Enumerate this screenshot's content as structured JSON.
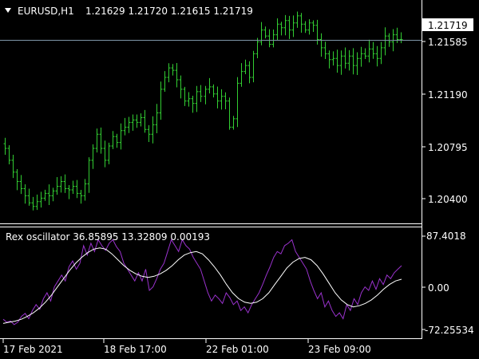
{
  "price_panel": {
    "symbol_label": "EURUSD,H1",
    "ohlc": "1.21629 1.21720 1.21615 1.21719",
    "current_price": "1.21719",
    "y_ticks": [
      "1.21585",
      "1.21190",
      "1.20795",
      "1.20400"
    ],
    "bar_color": "#32CD32",
    "current_line_color": "#7f96a8"
  },
  "oscillator_panel": {
    "title": "Rex oscillator 36.85895 13.32809 0.00193",
    "y_ticks": [
      "87.4018",
      "0.00",
      "-72.25534"
    ],
    "rex_color": "#9932CC",
    "signal_color": "#FFFFFF"
  },
  "time_axis": {
    "labels": [
      "17 Feb 2021",
      "18 Feb 17:00",
      "22 Feb 01:00",
      "23 Feb 09:00"
    ]
  },
  "chart_data": [
    {
      "type": "bar",
      "title": "EURUSD,H1",
      "ylim": [
        1.2018,
        1.22
      ],
      "y_ticks": [
        1.21585,
        1.2119,
        1.20795,
        1.204
      ],
      "closes": [
        1.208,
        1.207,
        1.206,
        1.2052,
        1.2046,
        1.204,
        1.2034,
        1.2031,
        1.2035,
        1.2038,
        1.2042,
        1.204,
        1.2044,
        1.2048,
        1.2052,
        1.2046,
        1.2045,
        1.2048,
        1.2042,
        1.204,
        1.205,
        1.207,
        1.208,
        1.2092,
        1.208,
        1.207,
        1.2082,
        1.209,
        1.2085,
        1.2095,
        1.2098,
        1.2102,
        1.2104,
        1.2102,
        1.2106,
        1.2096,
        1.2092,
        1.21,
        1.211,
        1.213,
        1.214,
        1.2148,
        1.2146,
        1.2138,
        1.213,
        1.212,
        1.2122,
        1.2118,
        1.2128,
        1.2124,
        1.213,
        1.2132,
        1.2126,
        1.212,
        1.2124,
        1.212,
        1.2098,
        1.2105,
        1.2135,
        1.2145,
        1.215,
        1.214,
        1.216,
        1.217,
        1.218,
        1.2175,
        1.2168,
        1.2176,
        1.2185,
        1.2182,
        1.2188,
        1.218,
        1.2186,
        1.2192,
        1.2185,
        1.218,
        1.2186,
        1.2184,
        1.2172,
        1.2165,
        1.216,
        1.2155,
        1.2156,
        1.215,
        1.2158,
        1.2152,
        1.2158,
        1.215,
        1.2156,
        1.216,
        1.2158,
        1.2164,
        1.216,
        1.2156,
        1.2165,
        1.2175,
        1.217,
        1.2176,
        1.2172,
        1.21719
      ]
    },
    {
      "type": "line",
      "title": "Rex oscillator 36.85895 13.32809 0.00193",
      "ylim": [
        -72.25534,
        87.4018
      ],
      "series": [
        {
          "values": [
            -55,
            -60,
            -58,
            -64,
            -60,
            -50,
            -45,
            -54,
            -40,
            -30,
            -38,
            -20,
            -10,
            -24,
            0,
            10,
            20,
            10,
            34,
            44,
            30,
            40,
            70,
            54,
            74,
            60,
            80,
            70,
            62,
            74,
            80,
            68,
            60,
            40,
            30,
            20,
            10,
            24,
            10,
            30,
            -6,
            0,
            14,
            30,
            40,
            60,
            80,
            70,
            60,
            80,
            70,
            64,
            50,
            40,
            30,
            10,
            -10,
            -24,
            -14,
            -20,
            -28,
            -10,
            -18,
            -30,
            -24,
            -40,
            -34,
            -44,
            -30,
            -20,
            -10,
            4,
            20,
            34,
            50,
            60,
            56,
            70,
            74,
            80,
            60,
            50,
            40,
            30,
            10,
            -6,
            -20,
            -10,
            -34,
            -24,
            -40,
            -50,
            -44,
            -54,
            -30,
            -40,
            -20,
            -30,
            -10,
            0,
            -6,
            10,
            -4,
            14,
            4,
            20,
            14,
            24,
            30,
            36
          ]
        },
        {
          "values": [
            -62,
            -60,
            -58,
            -55,
            -50,
            -44,
            -36,
            -26,
            -14,
            0,
            14,
            28,
            40,
            50,
            58,
            64,
            66,
            64,
            56,
            46,
            36,
            28,
            22,
            18,
            16,
            18,
            22,
            28,
            36,
            46,
            54,
            58,
            60,
            56,
            46,
            34,
            20,
            4,
            -10,
            -20,
            -26,
            -28,
            -26,
            -20,
            -10,
            4,
            18,
            32,
            42,
            48,
            50,
            46,
            36,
            22,
            6,
            -10,
            -22,
            -30,
            -34,
            -32,
            -28,
            -22,
            -14,
            -4,
            4,
            10,
            13
          ]
        }
      ]
    }
  ]
}
